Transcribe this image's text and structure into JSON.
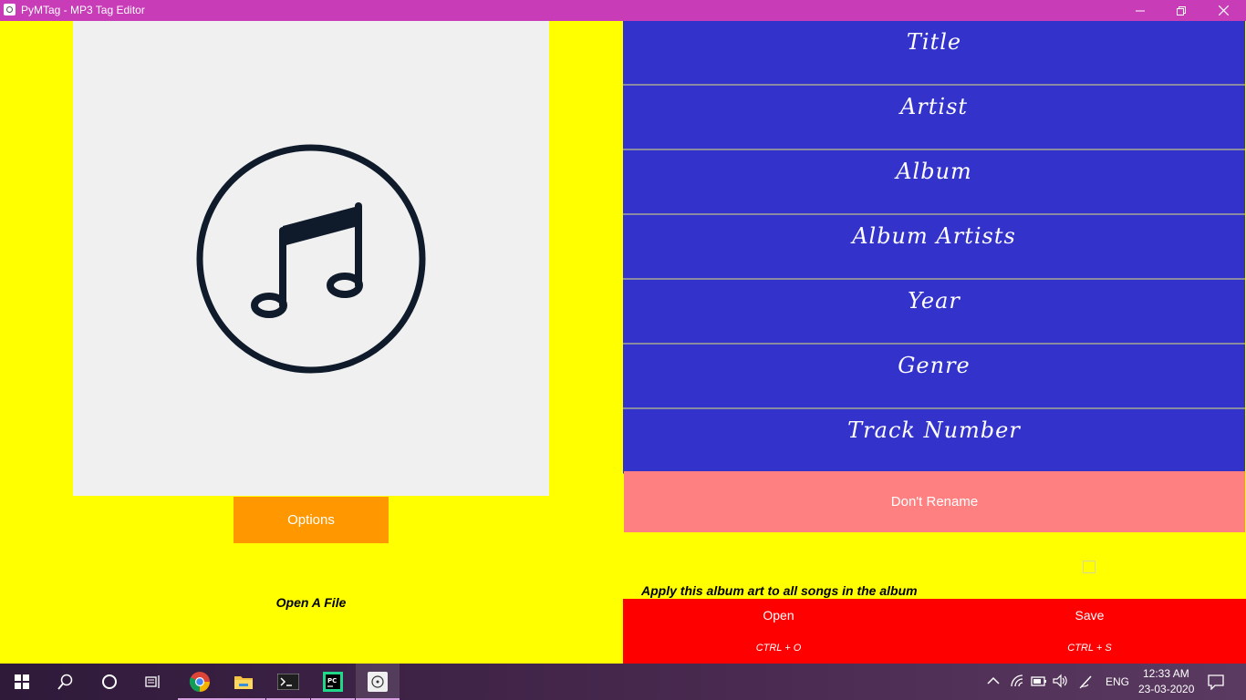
{
  "window": {
    "title": "PyMTag - MP3 Tag Editor"
  },
  "left_panel": {
    "options_label": "Options",
    "open_file_label": "Open A File"
  },
  "fields": [
    {
      "label": "Title"
    },
    {
      "label": "Artist"
    },
    {
      "label": "Album"
    },
    {
      "label": "Album Artists"
    },
    {
      "label": "Year"
    },
    {
      "label": "Genre"
    },
    {
      "label": "Track Number"
    }
  ],
  "rename_button": {
    "label": "Don't Rename"
  },
  "apply_album_art": {
    "label": "Apply this album art to all songs in the album",
    "checked": false
  },
  "actions": {
    "open": {
      "label": "Open",
      "shortcut": "CTRL + O"
    },
    "save": {
      "label": "Save",
      "shortcut": "CTRL + S"
    }
  },
  "taskbar": {
    "language": "ENG",
    "time": "12:33 AM",
    "date": "23-03-2020"
  },
  "colors": {
    "titlebar": "#c83cb8",
    "background": "#ffff00",
    "field_bg": "#3333cc",
    "options_btn": "#ff9800",
    "rename_btn": "#ff8080",
    "action_bar": "#ff0000"
  }
}
